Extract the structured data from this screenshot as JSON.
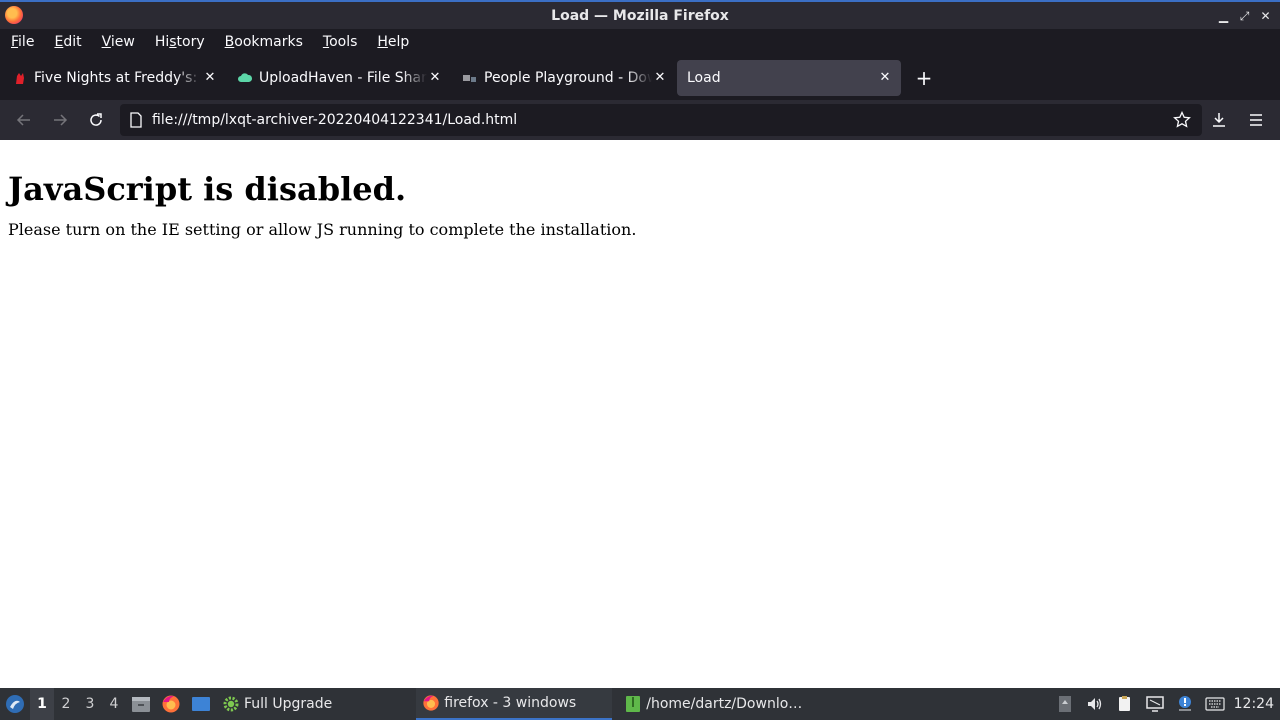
{
  "window": {
    "title": "Load — Mozilla Firefox",
    "controls": [
      "minimize-icon",
      "maximize-icon",
      "close-icon"
    ]
  },
  "menubar": {
    "items": [
      {
        "label": "File",
        "mnemonic": "F",
        "rest": "ile"
      },
      {
        "label": "Edit",
        "mnemonic": "E",
        "rest": "dit"
      },
      {
        "label": "View",
        "mnemonic": "V",
        "rest": "iew"
      },
      {
        "label": "History",
        "pre": "Hi",
        "mnemonic": "s",
        "rest": "tory"
      },
      {
        "label": "Bookmarks",
        "mnemonic": "B",
        "rest": "ookmarks"
      },
      {
        "label": "Tools",
        "mnemonic": "T",
        "rest": "ools"
      },
      {
        "label": "Help",
        "mnemonic": "H",
        "rest": "elp"
      }
    ]
  },
  "tabs": [
    {
      "label": "Five Nights at Freddy's: Security Breach",
      "icon": "fnaf-favicon",
      "active": false
    },
    {
      "label": "UploadHaven - File Sharing",
      "icon": "cloud-favicon",
      "active": false
    },
    {
      "label": "People Playground - Download",
      "icon": "game-favicon",
      "active": false
    },
    {
      "label": "Load",
      "icon": "",
      "active": true
    }
  ],
  "navbar": {
    "url": "file:///tmp/lxqt-archiver-20220404122341/Load.html"
  },
  "page": {
    "heading": "JavaScript is disabled.",
    "message": "Please turn on the IE setting or allow JS running to complete the installation."
  },
  "taskbar": {
    "desktops": [
      "1",
      "2",
      "3",
      "4"
    ],
    "current_desktop": "1",
    "tasks": [
      {
        "label": "Full Upgrade",
        "icon": "gear-icon"
      },
      {
        "label": "firefox - 3 windows",
        "icon": "firefox-icon"
      },
      {
        "label": "/home/dartz/Downlo…",
        "icon": "archive-icon"
      }
    ],
    "clock": "12:24"
  },
  "colors": {
    "accent": "#3b73c8",
    "toolbar": "#2b2a33",
    "tabbar": "#1c1b22",
    "active_tab": "#42414d",
    "taskbar": "#2f3237"
  }
}
